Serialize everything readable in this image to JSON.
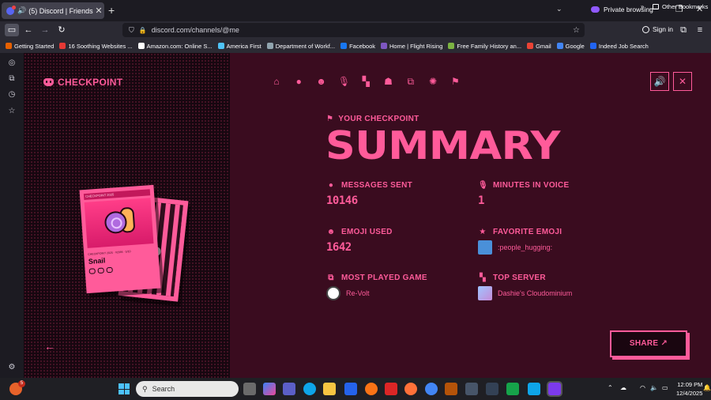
{
  "browser": {
    "tab": {
      "title": "(5) Discord | Friends"
    },
    "private_label": "Private browsing",
    "url": "discord.com/channels/@me",
    "signin_label": "Sign in",
    "bookmarks": [
      {
        "label": "Getting Started",
        "color": "#e66000"
      },
      {
        "label": "16 Soothing Websites ...",
        "color": "#e53935"
      },
      {
        "label": "Amazon.com: Online S...",
        "color": "#ffffff"
      },
      {
        "label": "America First",
        "color": "#4fc3f7"
      },
      {
        "label": "Department of Workf...",
        "color": "#90a4ae"
      },
      {
        "label": "Facebook",
        "color": "#1877f2"
      },
      {
        "label": "Home | Flight Rising",
        "color": "#7e57c2"
      },
      {
        "label": "Free Family History an...",
        "color": "#7cb342"
      },
      {
        "label": "Gmail",
        "color": "#ea4335"
      },
      {
        "label": "Google",
        "color": "#4285f4"
      },
      {
        "label": "Indeed Job Search",
        "color": "#2164f3"
      }
    ],
    "other_bookmarks": "Other Bookmarks"
  },
  "brand": {
    "name": "CHECKPOINT"
  },
  "card": {
    "header": "CHECKPOINT 2025",
    "meta": "CHECKPOINT 2025 · #2094 · 5/10",
    "name": "Snail"
  },
  "summary": {
    "eyebrow": "YOUR CHECKPOINT",
    "title": "SUMMARY"
  },
  "stats": {
    "messages": {
      "label": "MESSAGES SENT",
      "value": "10146"
    },
    "voice": {
      "label": "MINUTES IN VOICE",
      "value": "1"
    },
    "emoji_used": {
      "label": "EMOJI USED",
      "value": "1642"
    },
    "favorite_emoji": {
      "label": "FAVORITE EMOJI",
      "value": ":people_hugging:"
    },
    "game": {
      "label": "MOST PLAYED GAME",
      "value": "Re-Volt"
    },
    "server": {
      "label": "TOP SERVER",
      "value": "Dashie's Cloudominium"
    }
  },
  "share_label": "SHARE ↗",
  "taskbar": {
    "search_placeholder": "Search",
    "time": "12:09 PM",
    "date": "12/4/2025",
    "weather_badge": "5"
  },
  "colors": {
    "accent": "#ff5b9a",
    "page_bg": "#3a0c1f",
    "left_panel_bg": "#170710"
  }
}
